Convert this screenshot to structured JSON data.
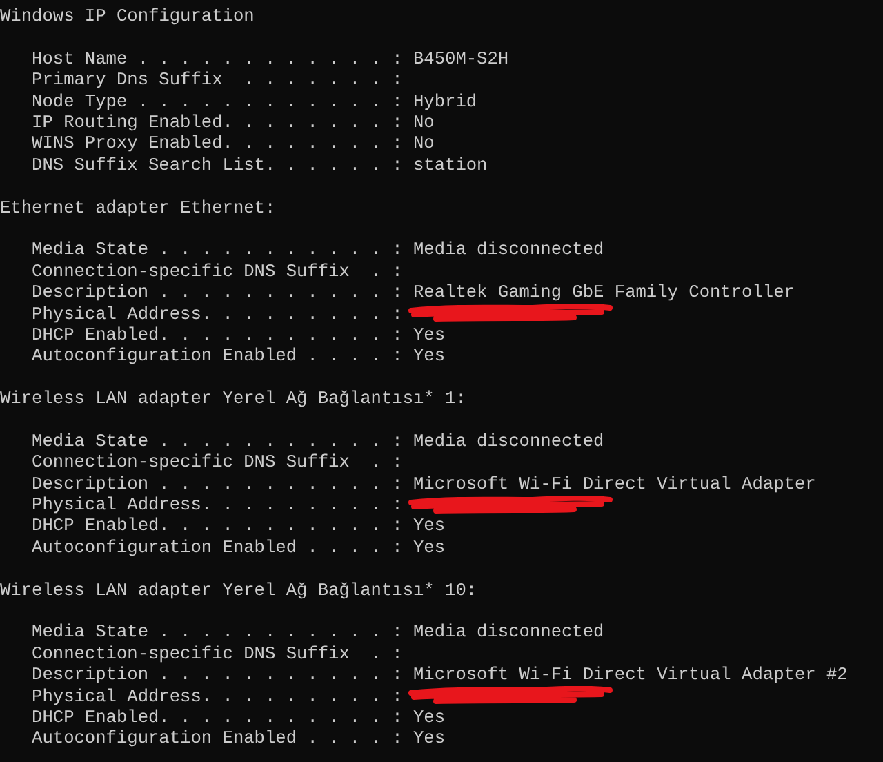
{
  "sections": [
    {
      "heading": "Windows IP Configuration",
      "entries": [
        {
          "label": "Host Name . . . . . . . . . . . . :",
          "value": "B450M-S2H"
        },
        {
          "label": "Primary Dns Suffix  . . . . . . . :"
        },
        {
          "label": "Node Type . . . . . . . . . . . . :",
          "value": "Hybrid"
        },
        {
          "label": "IP Routing Enabled. . . . . . . . :",
          "value": "No"
        },
        {
          "label": "WINS Proxy Enabled. . . . . . . . :",
          "value": "No"
        },
        {
          "label": "DNS Suffix Search List. . . . . . :",
          "value": "station"
        }
      ]
    },
    {
      "heading": "Ethernet adapter Ethernet:",
      "entries": [
        {
          "label": "Media State . . . . . . . . . . . :",
          "value": "Media disconnected"
        },
        {
          "label": "Connection-specific DNS Suffix  . :"
        },
        {
          "label": "Description . . . . . . . . . . . :",
          "value": "Realtek Gaming GbE Family Controller"
        },
        {
          "label": "Physical Address. . . . . . . . . :",
          "redacted": true
        },
        {
          "label": "DHCP Enabled. . . . . . . . . . . :",
          "value": "Yes"
        },
        {
          "label": "Autoconfiguration Enabled . . . . :",
          "value": "Yes"
        }
      ]
    },
    {
      "heading": "Wireless LAN adapter Yerel Ağ Bağlantısı* 1:",
      "entries": [
        {
          "label": "Media State . . . . . . . . . . . :",
          "value": "Media disconnected"
        },
        {
          "label": "Connection-specific DNS Suffix  . :"
        },
        {
          "label": "Description . . . . . . . . . . . :",
          "value": "Microsoft Wi-Fi Direct Virtual Adapter"
        },
        {
          "label": "Physical Address. . . . . . . . . :",
          "redacted": true
        },
        {
          "label": "DHCP Enabled. . . . . . . . . . . :",
          "value": "Yes"
        },
        {
          "label": "Autoconfiguration Enabled . . . . :",
          "value": "Yes"
        }
      ]
    },
    {
      "heading": "Wireless LAN adapter Yerel Ağ Bağlantısı* 10:",
      "entries": [
        {
          "label": "Media State . . . . . . . . . . . :",
          "value": "Media disconnected"
        },
        {
          "label": "Connection-specific DNS Suffix  . :"
        },
        {
          "label": "Description . . . . . . . . . . . :",
          "value": "Microsoft Wi-Fi Direct Virtual Adapter #2"
        },
        {
          "label": "Physical Address. . . . . . . . . :",
          "redacted": true
        },
        {
          "label": "DHCP Enabled. . . . . . . . . . . :",
          "value": "Yes"
        },
        {
          "label": "Autoconfiguration Enabled . . . . :",
          "value": "Yes"
        }
      ]
    }
  ]
}
